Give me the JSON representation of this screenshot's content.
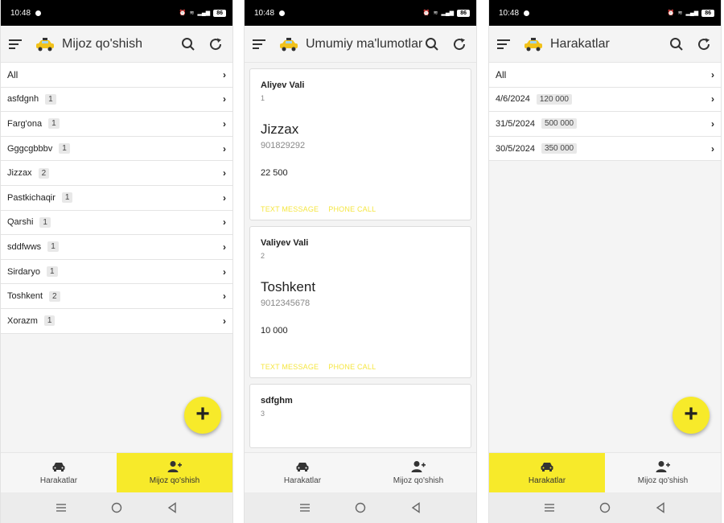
{
  "status": {
    "time": "10:48",
    "battery": "86"
  },
  "colors": {
    "accent": "#f7ea2a",
    "action_text": "#f5e642"
  },
  "nav": {
    "left": "Harakatlar",
    "right": "Mijoz qo'shish"
  },
  "screen1": {
    "title": "Mijoz qo'shish",
    "all": "All",
    "regions": [
      {
        "name": "asfdgnh",
        "count": "1"
      },
      {
        "name": "Farg'ona",
        "count": "1"
      },
      {
        "name": "Gggcgbbbv",
        "count": "1"
      },
      {
        "name": "Jizzax",
        "count": "2"
      },
      {
        "name": "Pastkichaqir",
        "count": "1"
      },
      {
        "name": "Qarshi",
        "count": "1"
      },
      {
        "name": "sddfwws",
        "count": "1"
      },
      {
        "name": "Sirdaryo",
        "count": "1"
      },
      {
        "name": "Toshkent",
        "count": "2"
      },
      {
        "name": "Xorazm",
        "count": "1"
      }
    ]
  },
  "screen2": {
    "title": "Umumiy ma'lumotlar",
    "text_message": "TEXT MESSAGE",
    "phone_call": "PHONE CALL",
    "clients": [
      {
        "name": "Aliyev Vali",
        "id": "1",
        "city": "Jizzax",
        "phone": "901829292",
        "amount": "22 500"
      },
      {
        "name": "Valiyev Vali",
        "id": "2",
        "city": "Toshkent",
        "phone": "9012345678",
        "amount": "10 000"
      },
      {
        "name": "sdfghm",
        "id": "3"
      }
    ]
  },
  "screen3": {
    "title": "Harakatlar",
    "all": "All",
    "entries": [
      {
        "date": "4/6/2024",
        "amount": "120 000"
      },
      {
        "date": "31/5/2024",
        "amount": "500 000"
      },
      {
        "date": "30/5/2024",
        "amount": "350 000"
      }
    ]
  }
}
